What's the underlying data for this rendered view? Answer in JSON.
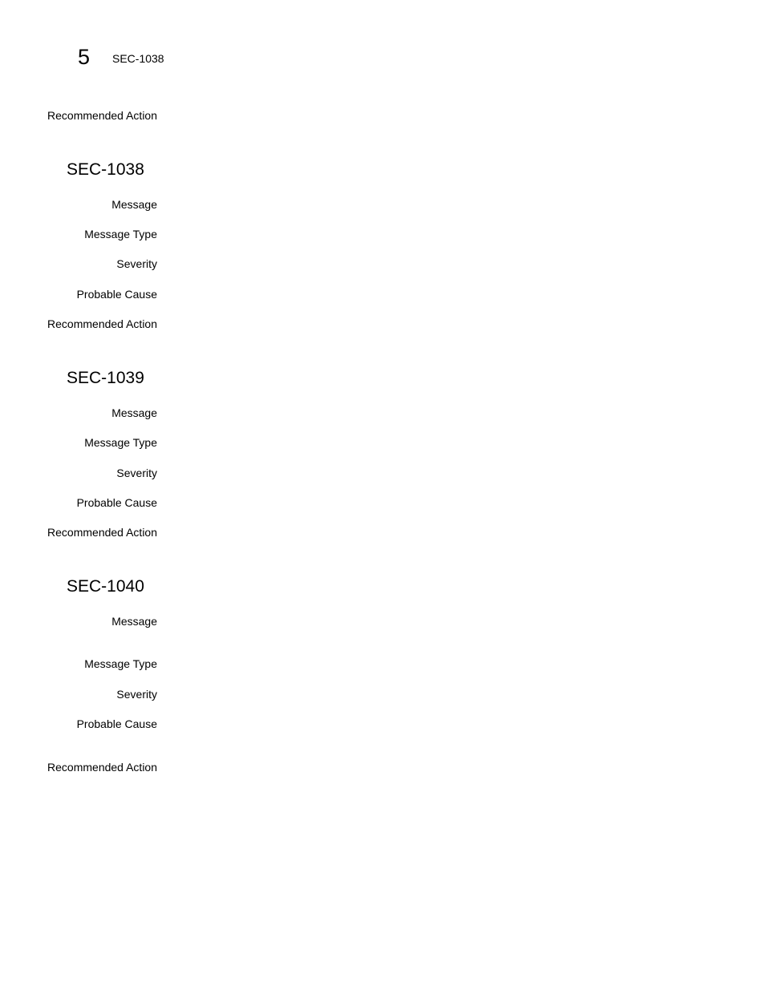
{
  "header": {
    "chapter_number": "5",
    "running_title": "SEC-1038"
  },
  "carryover": {
    "recommended_action_label": "Recommended Action"
  },
  "sections": [
    {
      "title": "SEC-1038",
      "labels": {
        "message": "Message",
        "message_type": "Message Type",
        "severity": "Severity",
        "probable_cause": "Probable Cause",
        "recommended_action": "Recommended Action"
      }
    },
    {
      "title": "SEC-1039",
      "labels": {
        "message": "Message",
        "message_type": "Message Type",
        "severity": "Severity",
        "probable_cause": "Probable Cause",
        "recommended_action": "Recommended Action"
      }
    },
    {
      "title": "SEC-1040",
      "labels": {
        "message": "Message",
        "message_type": "Message Type",
        "severity": "Severity",
        "probable_cause": "Probable Cause",
        "recommended_action": "Recommended Action"
      }
    }
  ]
}
